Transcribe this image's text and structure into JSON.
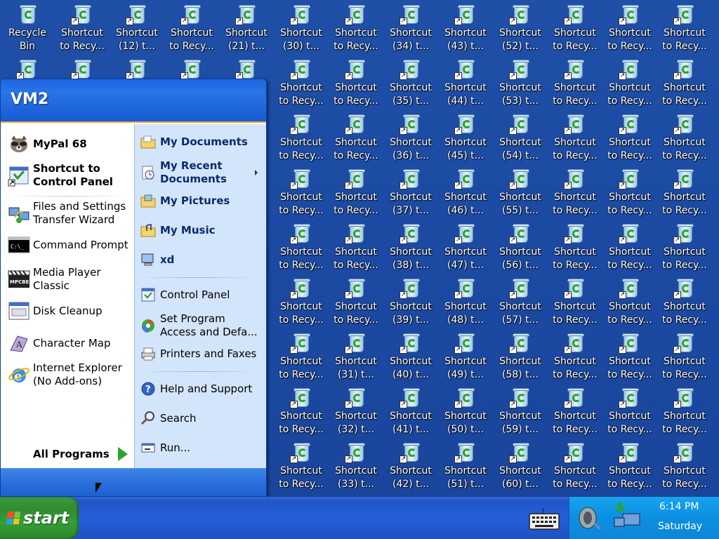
{
  "desktop": {
    "icons": [
      {
        "label1": "Recycle",
        "label2": "Bin",
        "type": "bin"
      },
      {
        "label1": "Shortcut",
        "label2": "to Recy..."
      },
      {
        "label1": "Shortcut",
        "label2": "(12) t..."
      },
      {
        "label1": "Shortcut",
        "label2": "to Recy..."
      },
      {
        "label1": "Shortcut",
        "label2": "(21) t..."
      },
      {
        "label1": "Shortcut",
        "label2": "(30) t..."
      },
      {
        "label1": "Shortcut",
        "label2": "to Recy..."
      },
      {
        "label1": "Shortcut",
        "label2": "(34) t..."
      },
      {
        "label1": "Shortcut",
        "label2": "(43) t..."
      },
      {
        "label1": "Shortcut",
        "label2": "(52) t..."
      },
      {
        "label1": "Shortcut",
        "label2": "to Recy..."
      },
      {
        "label1": "Shortcut",
        "label2": "to Recy..."
      },
      {
        "label1": "Shortcut",
        "label2": "to Recy..."
      }
    ],
    "grid_right": [
      [
        {
          "label1": "Shortcut",
          "label2": "to Recy..."
        },
        {
          "label1": "Shortcut",
          "label2": "to Recy..."
        },
        {
          "label1": "Shortcut",
          "label2": "(35) t..."
        },
        {
          "label1": "Shortcut",
          "label2": "(44) t..."
        },
        {
          "label1": "Shortcut",
          "label2": "(53) t..."
        },
        {
          "label1": "Shortcut",
          "label2": "to Recy..."
        },
        {
          "label1": "Shortcut",
          "label2": "to Recy..."
        },
        {
          "label1": "Shortcut",
          "label2": "to Recy..."
        }
      ],
      [
        {
          "label1": "Shortcut",
          "label2": "to Recy..."
        },
        {
          "label1": "Shortcut",
          "label2": "to Recy..."
        },
        {
          "label1": "Shortcut",
          "label2": "(36) t..."
        },
        {
          "label1": "Shortcut",
          "label2": "(45) t..."
        },
        {
          "label1": "Shortcut",
          "label2": "(54) t..."
        },
        {
          "label1": "Shortcut",
          "label2": "to Recy..."
        },
        {
          "label1": "Shortcut",
          "label2": "to Recy..."
        },
        {
          "label1": "Shortcut",
          "label2": "to Recy..."
        }
      ],
      [
        {
          "label1": "Shortcut",
          "label2": "to Recy..."
        },
        {
          "label1": "Shortcut",
          "label2": "to Recy..."
        },
        {
          "label1": "Shortcut",
          "label2": "(37) t..."
        },
        {
          "label1": "Shortcut",
          "label2": "(46) t..."
        },
        {
          "label1": "Shortcut",
          "label2": "(55) t..."
        },
        {
          "label1": "Shortcut",
          "label2": "to Recy..."
        },
        {
          "label1": "Shortcut",
          "label2": "to Recy..."
        },
        {
          "label1": "Shortcut",
          "label2": "to Recy..."
        }
      ],
      [
        {
          "label1": "Shortcut",
          "label2": "to Recy..."
        },
        {
          "label1": "Shortcut",
          "label2": "to Recy..."
        },
        {
          "label1": "Shortcut",
          "label2": "(38) t..."
        },
        {
          "label1": "Shortcut",
          "label2": "(47) t..."
        },
        {
          "label1": "Shortcut",
          "label2": "(56) t..."
        },
        {
          "label1": "Shortcut",
          "label2": "to Recy..."
        },
        {
          "label1": "Shortcut",
          "label2": "to Recy..."
        },
        {
          "label1": "Shortcut",
          "label2": "to Recy..."
        }
      ],
      [
        {
          "label1": "Shortcut",
          "label2": "to Recy..."
        },
        {
          "label1": "Shortcut",
          "label2": "to Recy..."
        },
        {
          "label1": "Shortcut",
          "label2": "(39) t..."
        },
        {
          "label1": "Shortcut",
          "label2": "(48) t..."
        },
        {
          "label1": "Shortcut",
          "label2": "(57) t..."
        },
        {
          "label1": "Shortcut",
          "label2": "to Recy..."
        },
        {
          "label1": "Shortcut",
          "label2": "to Recy..."
        },
        {
          "label1": "Shortcut",
          "label2": "to Recy..."
        }
      ],
      [
        {
          "label1": "Shortcut",
          "label2": "to Recy..."
        },
        {
          "label1": "Shortcut",
          "label2": "(31) t..."
        },
        {
          "label1": "Shortcut",
          "label2": "(40) t..."
        },
        {
          "label1": "Shortcut",
          "label2": "(49) t..."
        },
        {
          "label1": "Shortcut",
          "label2": "(58) t..."
        },
        {
          "label1": "Shortcut",
          "label2": "to Recy..."
        },
        {
          "label1": "Shortcut",
          "label2": "to Recy..."
        },
        {
          "label1": "Shortcut",
          "label2": "to Recy..."
        }
      ],
      [
        {
          "label1": "Shortcut",
          "label2": "to Recy..."
        },
        {
          "label1": "Shortcut",
          "label2": "(32) t..."
        },
        {
          "label1": "Shortcut",
          "label2": "(41) t..."
        },
        {
          "label1": "Shortcut",
          "label2": "(50) t..."
        },
        {
          "label1": "Shortcut",
          "label2": "(59) t..."
        },
        {
          "label1": "Shortcut",
          "label2": "to Recy..."
        },
        {
          "label1": "Shortcut",
          "label2": "to Recy..."
        },
        {
          "label1": "Shortcut",
          "label2": "to Recy..."
        }
      ],
      [
        {
          "label1": "Shortcut",
          "label2": "to Recy..."
        },
        {
          "label1": "Shortcut",
          "label2": "(33) t..."
        },
        {
          "label1": "Shortcut",
          "label2": "(42) t..."
        },
        {
          "label1": "Shortcut",
          "label2": "(51) t..."
        },
        {
          "label1": "Shortcut",
          "label2": "(60) t..."
        },
        {
          "label1": "Shortcut",
          "label2": "to Recy..."
        },
        {
          "label1": "Shortcut",
          "label2": "to Recy..."
        },
        {
          "label1": "Shortcut",
          "label2": "to Recy..."
        }
      ]
    ]
  },
  "start_menu": {
    "user_name": "VM2",
    "pinned": [
      {
        "label": "MyPal 68",
        "icon": "raccoon-icon"
      },
      {
        "label": "Shortcut to Control Panel",
        "line1": "Shortcut to",
        "line2": "Control Panel",
        "icon": "control-panel-icon"
      }
    ],
    "recent": [
      {
        "line1": "Files and Settings",
        "line2": "Transfer Wizard",
        "icon": "transfer-wizard-icon"
      },
      {
        "line1": "Command Prompt",
        "icon": "command-prompt-icon"
      },
      {
        "line1": "Media Player",
        "line2": "Classic",
        "icon": "mpc-icon"
      },
      {
        "line1": "Disk Cleanup",
        "icon": "disk-cleanup-icon"
      },
      {
        "line1": "Character Map",
        "icon": "character-map-icon"
      },
      {
        "line1": "Internet Explorer",
        "line2": "(No Add-ons)",
        "icon": "internet-explorer-icon"
      }
    ],
    "all_programs": "All Programs",
    "right_bold": [
      {
        "label": "My Documents",
        "icon": "folder-icon"
      },
      {
        "line1": "My Recent",
        "line2": "Documents",
        "icon": "recent-docs-icon"
      },
      {
        "label": "My Pictures",
        "icon": "folder-icon"
      },
      {
        "label": "My Music",
        "icon": "folder-icon"
      },
      {
        "label": "xd",
        "icon": "computer-icon"
      }
    ],
    "right_normal": [
      {
        "label": "Control Panel",
        "icon": "control-panel-icon"
      },
      {
        "line1": "Set Program",
        "line2": "Access and Defa...",
        "icon": "set-program-icon"
      },
      {
        "label": "Printers and Faxes",
        "icon": "printer-icon"
      },
      {
        "label": "Help and Support",
        "icon": "help-icon"
      },
      {
        "label": "Search",
        "icon": "search-icon"
      },
      {
        "label": "Run...",
        "icon": "run-icon"
      }
    ]
  },
  "taskbar": {
    "start_label": "start",
    "clock_time": "6:14 PM",
    "clock_day": "Saturday"
  },
  "colors": {
    "desktop": "#1c4ba4",
    "start_green": "#35a035",
    "menu_header": "#1c65e0",
    "tray": "#0c8fe0"
  }
}
